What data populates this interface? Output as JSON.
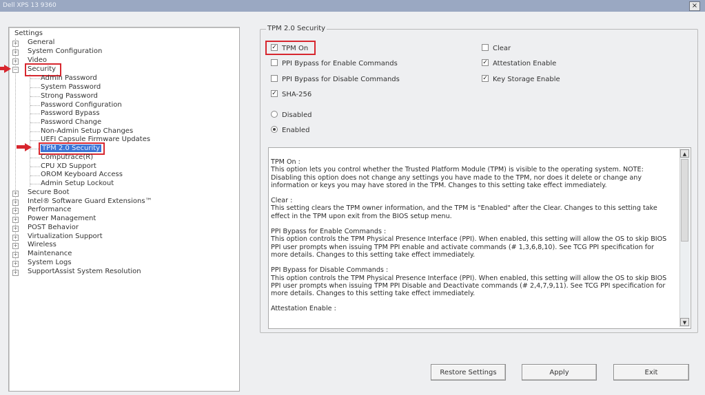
{
  "window": {
    "title": "Dell XPS 13 9360",
    "close": "×"
  },
  "tree": {
    "root": "Settings",
    "items": [
      {
        "label": "General"
      },
      {
        "label": "System Configuration"
      },
      {
        "label": "Video"
      },
      {
        "label": "Security"
      },
      {
        "label": "Admin Password"
      },
      {
        "label": "System Password"
      },
      {
        "label": "Strong Password"
      },
      {
        "label": "Password Configuration"
      },
      {
        "label": "Password Bypass"
      },
      {
        "label": "Password Change"
      },
      {
        "label": "Non-Admin Setup Changes"
      },
      {
        "label": "UEFI Capsule Firmware Updates"
      },
      {
        "label": "TPM 2.0 Security"
      },
      {
        "label": "Computrace(R)"
      },
      {
        "label": "CPU XD Support"
      },
      {
        "label": "OROM Keyboard Access"
      },
      {
        "label": "Admin Setup Lockout"
      },
      {
        "label": "Secure Boot"
      },
      {
        "label": "Intel® Software Guard Extensions™"
      },
      {
        "label": "Performance"
      },
      {
        "label": "Power Management"
      },
      {
        "label": "POST Behavior"
      },
      {
        "label": "Virtualization Support"
      },
      {
        "label": "Wireless"
      },
      {
        "label": "Maintenance"
      },
      {
        "label": "System Logs"
      },
      {
        "label": "SupportAssist System Resolution"
      }
    ],
    "expander_plus": "+",
    "expander_minus": "−"
  },
  "group": {
    "title": "TPM 2.0 Security",
    "options": {
      "tpm_on": {
        "label": "TPM On",
        "checked": true
      },
      "ppi_enable": {
        "label": "PPI Bypass for Enable Commands",
        "checked": false
      },
      "ppi_disable": {
        "label": "PPI Bypass for Disable Commands",
        "checked": false
      },
      "sha256": {
        "label": "SHA-256",
        "checked": true
      },
      "clear": {
        "label": "Clear",
        "checked": false
      },
      "attestation": {
        "label": "Attestation Enable",
        "checked": true
      },
      "key_storage": {
        "label": "Key Storage Enable",
        "checked": true
      }
    },
    "radios": {
      "disabled": {
        "label": "Disabled",
        "selected": false
      },
      "enabled": {
        "label": "Enabled",
        "selected": true
      }
    },
    "check_glyph": "✓"
  },
  "help": {
    "tpm_on_h": "TPM On :",
    "tpm_on_body": "This option lets you control whether the Trusted Platform Module (TPM) is visible to the operating system. NOTE: Disabling this option does not change any settings you have made to the TPM, nor does it delete or change any information or keys you may have stored in the TPM.  Changes to this setting take effect immediately.",
    "clear_h": "Clear :",
    "clear_body": "This setting clears the TPM owner information, and the TPM is \"Enabled\" after the Clear.  Changes to this setting take effect in the TPM upon exit from the BIOS setup menu.",
    "ppi_en_h": "PPI Bypass for Enable Commands :",
    "ppi_en_body": "This option controls the TPM Physical Presence Interface (PPI). When enabled, this setting will allow the OS to skip BIOS PPI user prompts when issuing TPM PPI enable and activate commands (# 1,3,6,8,10).  See TCG PPI specification for more details. Changes to this setting take effect immediately.",
    "ppi_dis_h": "PPI Bypass for Disable Commands :",
    "ppi_dis_body": "This option controls the TPM Physical Presence Interface (PPI). When enabled, this setting will allow the OS to skip BIOS PPI user prompts when issuing TPM PPI Disable and Deactivate commands (# 2,4,7,9,11).  See TCG PPI specification for more details.  Changes to this setting take effect immediately.",
    "att_h": "Attestation Enable :",
    "scroll_up": "▲",
    "scroll_down": "▼"
  },
  "buttons": {
    "restore": "Restore Settings",
    "apply": "Apply",
    "exit": "Exit"
  },
  "colors": {
    "highlight": "#d7262e",
    "selection": "#3a74d6"
  }
}
